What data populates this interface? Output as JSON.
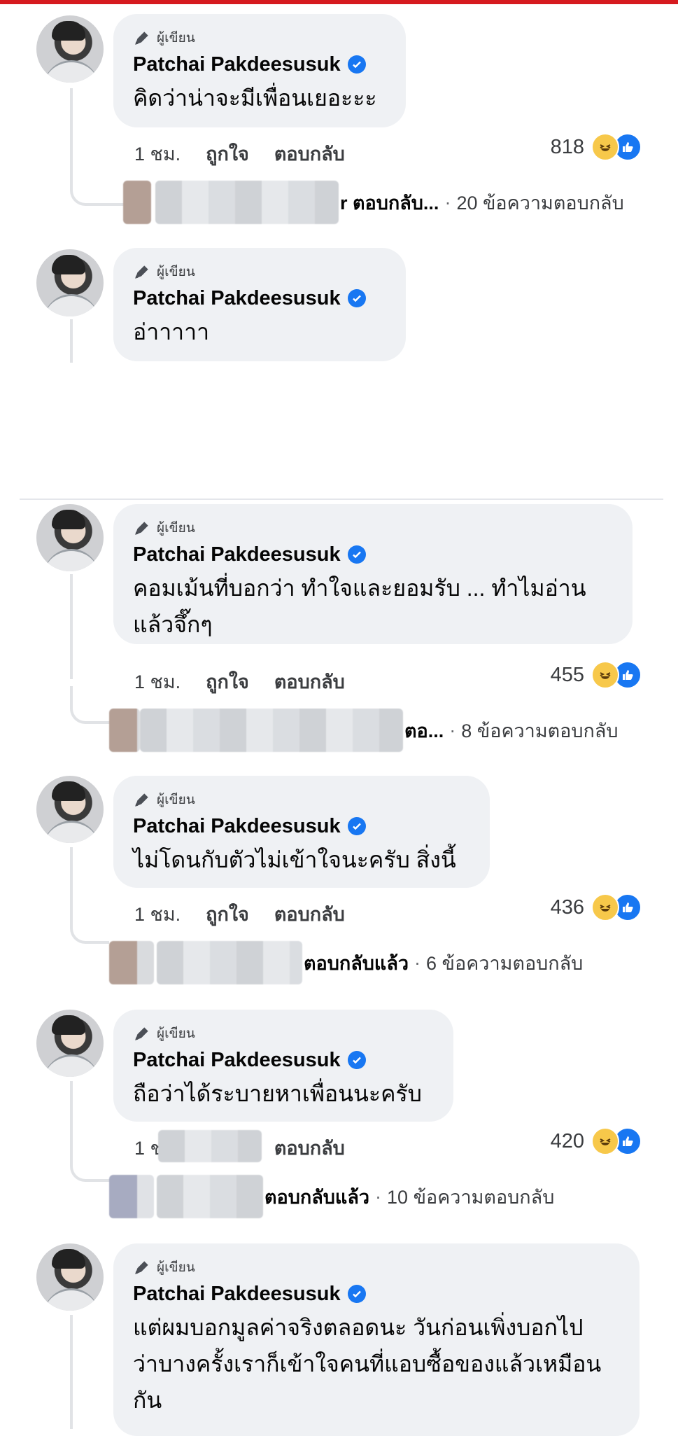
{
  "author_badge": "ผู้เขียน",
  "author_name": "Patchai Pakdeesusuk",
  "actions": {
    "like": "ถูกใจ",
    "reply": "ตอบกลับ"
  },
  "comments": [
    {
      "text": "คิดว่าน่าจะมีเพื่อนเยอะะะ",
      "time": "1 ชม.",
      "reactions": "818",
      "reply_suffix": "r ตอบกลับ...",
      "reply_count": "20 ข้อความตอบกลับ"
    },
    {
      "text": "อ่าาาาา"
    },
    {
      "text_lines": [
        "คอมเม้นที่บอกว่า ทำใจและยอมรับ ... ทำไมอ่าน",
        "แล้วจึ๊กๆ"
      ],
      "time": "1 ชม.",
      "reactions": "455",
      "reply_suffix": "ตอ...",
      "reply_count": "8 ข้อความตอบกลับ"
    },
    {
      "text": "ไม่โดนกับตัวไม่เข้าใจนะครับ สิ่งนี้",
      "time": "1 ชม.",
      "reactions": "436",
      "reply_suffix": "ตอบกลับแล้ว",
      "reply_count": "6 ข้อความตอบกลับ"
    },
    {
      "text": "ถือว่าได้ระบายหาเพื่อนนะครับ",
      "time": "1 ชม.",
      "reactions": "420",
      "reply_suffix": "ตอบกลับแล้ว",
      "reply_count": "10 ข้อความตอบกลับ"
    },
    {
      "text_lines": [
        "แต่ผมบอกมูลค่าจริงตลอดนะ วันก่อนเพิ่งบอกไป",
        "ว่าบางครั้งเราก็เข้าใจคนที่แอบซื้อของแล้วเหมือน",
        "กัน"
      ]
    }
  ],
  "colors": {
    "accent_bar": "#d61a1f",
    "bubble": "#eff1f4",
    "verified": "#1877f2",
    "haha": "#f7c84a"
  },
  "icons": [
    "pen-icon",
    "verified-icon",
    "haha-reaction-icon",
    "like-reaction-icon"
  ]
}
